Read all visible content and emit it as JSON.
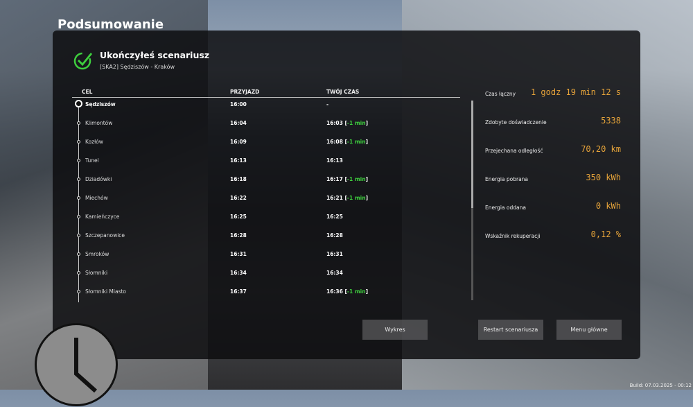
{
  "title": "Podsumowanie",
  "result": {
    "heading": "Ukończyłeś scenariusz",
    "scenario": "[SKA2] Sędziszów - Kraków"
  },
  "table": {
    "headers": [
      "CEL",
      "PRZYJAZD",
      "TWÓJ CZAS"
    ],
    "rows": [
      {
        "station": "Sędziszów",
        "arrival": "16:00",
        "time": "-",
        "diff": ""
      },
      {
        "station": "Klimontów",
        "arrival": "16:04",
        "time": "16:03",
        "diff": "-1 min"
      },
      {
        "station": "Kozłów",
        "arrival": "16:09",
        "time": "16:08",
        "diff": "-1 min"
      },
      {
        "station": "Tunel",
        "arrival": "16:13",
        "time": "16:13",
        "diff": ""
      },
      {
        "station": "Dziadówki",
        "arrival": "16:18",
        "time": "16:17",
        "diff": "-1 min"
      },
      {
        "station": "Miechów",
        "arrival": "16:22",
        "time": "16:21",
        "diff": "-1 min"
      },
      {
        "station": "Kamieńczyce",
        "arrival": "16:25",
        "time": "16:25",
        "diff": ""
      },
      {
        "station": "Szczepanowice",
        "arrival": "16:28",
        "time": "16:28",
        "diff": ""
      },
      {
        "station": "Smroków",
        "arrival": "16:31",
        "time": "16:31",
        "diff": ""
      },
      {
        "station": "Słomniki",
        "arrival": "16:34",
        "time": "16:34",
        "diff": ""
      },
      {
        "station": "Słomniki Miasto",
        "arrival": "16:37",
        "time": "16:36",
        "diff": "-1 min"
      }
    ]
  },
  "stats": [
    {
      "label": "Czas łączny",
      "value": "1 godz 19 min 12 s"
    },
    {
      "label": "Zdobyte doświadczenie",
      "value": "5338"
    },
    {
      "label": "Przejechana odległość",
      "value": "70,20 km"
    },
    {
      "label": "Energia pobrana",
      "value": "350 kWh"
    },
    {
      "label": "Energia oddana",
      "value": "0 kWh"
    },
    {
      "label": "Wskaźnik rekuperacji",
      "value": "0,12 %"
    }
  ],
  "buttons": {
    "chart": "Wykres",
    "restart": "Restart scenariusza",
    "menu": "Menu główne"
  },
  "build": "Build: 07.03.2025 - 00:12",
  "colors": {
    "accent": "#e7a43a",
    "success": "#3ecf3e"
  }
}
